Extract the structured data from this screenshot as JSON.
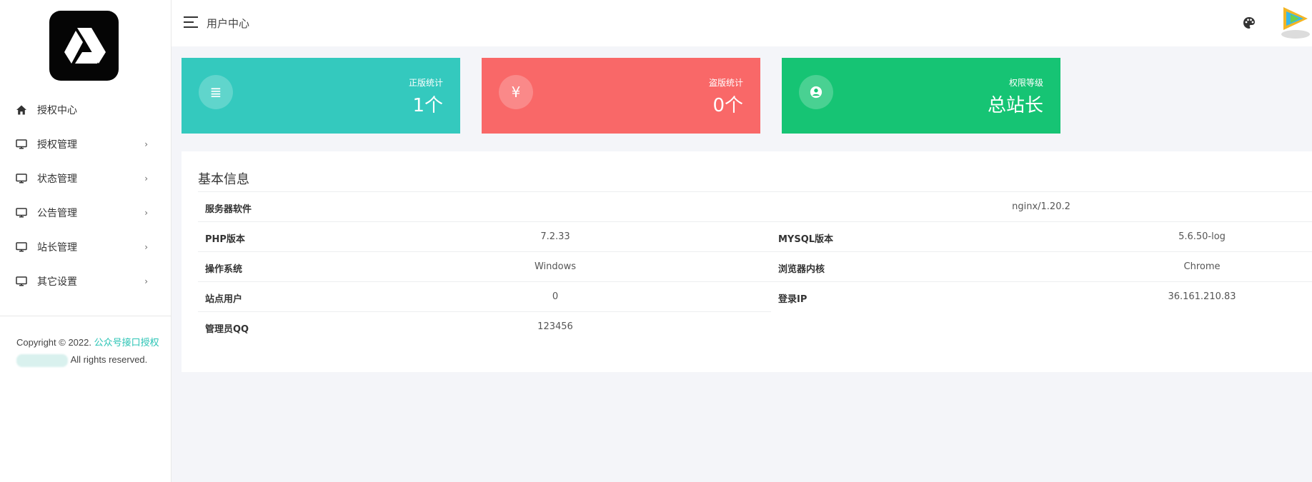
{
  "sidebar": {
    "logo": "drive-logo-icon",
    "items": [
      {
        "label": "授权中心",
        "icon": "home-icon",
        "has_children": false
      },
      {
        "label": "授权管理",
        "icon": "monitor-icon",
        "has_children": true
      },
      {
        "label": "状态管理",
        "icon": "monitor-icon",
        "has_children": true
      },
      {
        "label": "公告管理",
        "icon": "monitor-icon",
        "has_children": true
      },
      {
        "label": "站长管理",
        "icon": "monitor-icon",
        "has_children": true
      },
      {
        "label": "其它设置",
        "icon": "monitor-icon",
        "has_children": true
      }
    ],
    "chevron": "›",
    "copyright_prefix": "Copyright © 2022.",
    "copyright_link": "公众号接口授权",
    "copyright_suffix": "All rights reserved."
  },
  "header": {
    "title": "用户中心",
    "palette_icon": "palette-icon",
    "avatar_icon": "avatar-icon"
  },
  "stats": [
    {
      "label": "正版统计",
      "value": "1个",
      "icon": "list-icon",
      "glyph": "≣",
      "color": "#34c9be"
    },
    {
      "label": "盗版统计",
      "value": "0个",
      "icon": "yen-icon",
      "glyph": "¥",
      "color": "#f96868"
    },
    {
      "label": "权限等级",
      "value": "总站长",
      "icon": "user-circle-icon",
      "glyph": "●",
      "color": "#16c474"
    }
  ],
  "info": {
    "title": "基本信息",
    "server_software": {
      "label": "服务器软件",
      "value": "nginx/1.20.2"
    },
    "php_version": {
      "label": "PHP版本",
      "value": "7.2.33"
    },
    "mysql_version": {
      "label": "MYSQL版本",
      "value": "5.6.50-log"
    },
    "os": {
      "label": "操作系统",
      "value": "Windows"
    },
    "browser_engine": {
      "label": "浏览器内核",
      "value": "Chrome"
    },
    "site_users": {
      "label": "站点用户",
      "value": "0"
    },
    "login_ip": {
      "label": "登录IP",
      "value": "36.161.210.83"
    },
    "admin_qq": {
      "label": "管理员QQ",
      "value": "123456"
    }
  }
}
